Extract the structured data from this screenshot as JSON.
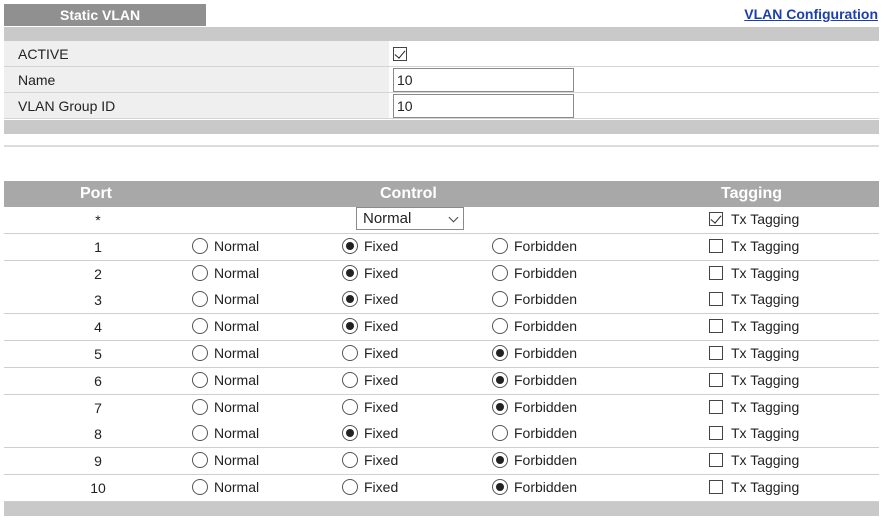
{
  "header": {
    "tab_title": "Static VLAN",
    "config_link": "VLAN Configuration"
  },
  "form": {
    "active_label": "ACTIVE",
    "active_checked": true,
    "name_label": "Name",
    "name_value": "10",
    "group_label": "VLAN Group ID",
    "group_value": "10"
  },
  "table": {
    "col_port": "Port",
    "col_control": "Control",
    "col_tagging": "Tagging",
    "all_row": {
      "port": "*",
      "control_select": "Normal",
      "tx_tagging_checked": true,
      "tx_label": "Tx Tagging"
    },
    "radio_labels": [
      "Normal",
      "Fixed",
      "Forbidden"
    ],
    "tx_label": "Tx Tagging",
    "rows": [
      {
        "port": "1",
        "control": "Fixed",
        "tx": false
      },
      {
        "port": "2",
        "control": "Fixed",
        "tx": false
      },
      {
        "port": "3",
        "control": "Fixed",
        "tx": false
      },
      {
        "port": "4",
        "control": "Fixed",
        "tx": false
      },
      {
        "port": "5",
        "control": "Forbidden",
        "tx": false
      },
      {
        "port": "6",
        "control": "Forbidden",
        "tx": false
      },
      {
        "port": "7",
        "control": "Forbidden",
        "tx": false
      },
      {
        "port": "8",
        "control": "Fixed",
        "tx": false
      },
      {
        "port": "9",
        "control": "Forbidden",
        "tx": false
      },
      {
        "port": "10",
        "control": "Forbidden",
        "tx": false
      }
    ]
  },
  "colors": {
    "tab_bg": "#909090",
    "header_bg": "#a8a8a8",
    "link": "#1c3fae"
  }
}
